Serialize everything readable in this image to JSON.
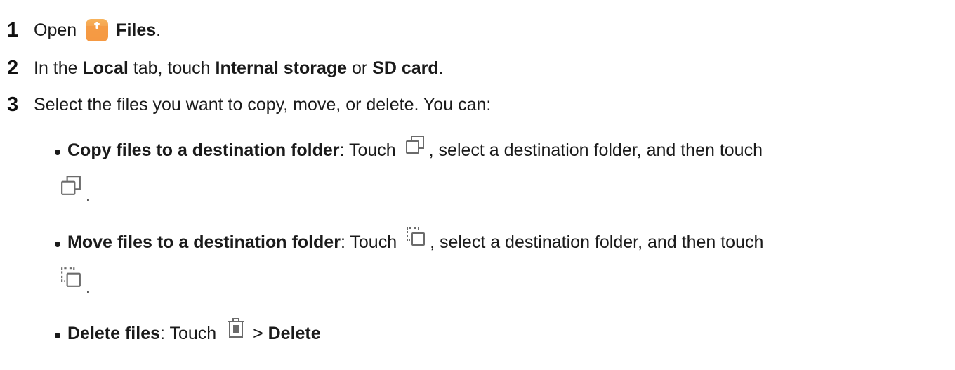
{
  "steps": [
    {
      "number": "1",
      "parts": {
        "pre": "Open",
        "app_icon": "files-app-icon",
        "app_name": "Files",
        "post": "."
      }
    },
    {
      "number": "2",
      "parts": {
        "t1": "In the ",
        "b1": "Local",
        "t2": " tab, touch ",
        "b2": "Internal storage",
        "t3": " or ",
        "b3": "SD card",
        "t4": "."
      }
    },
    {
      "number": "3",
      "text": "Select the files you want to copy, move, or delete. You can:"
    }
  ],
  "bullets": {
    "copy": {
      "title": "Copy files to a destination folder",
      "colon": ":",
      "touch": " Touch ",
      "icon": "copy-icon",
      "rest": ", select a destination folder, and then touch",
      "end": "."
    },
    "move": {
      "title": "Move files to a destination folder",
      "colon": ":",
      "touch": " Touch ",
      "icon": "move-icon",
      "rest": ", select a destination folder, and then touch",
      "end": "."
    },
    "delete": {
      "title": "Delete files",
      "colon": ":",
      "touch": " Touch ",
      "icon": "trash-icon",
      "sep": " > ",
      "action": "Delete"
    }
  },
  "colors": {
    "text": "#1a1a1a",
    "icon_gray": "#6b6b6b",
    "files_icon_orange": "#f5a04a"
  }
}
